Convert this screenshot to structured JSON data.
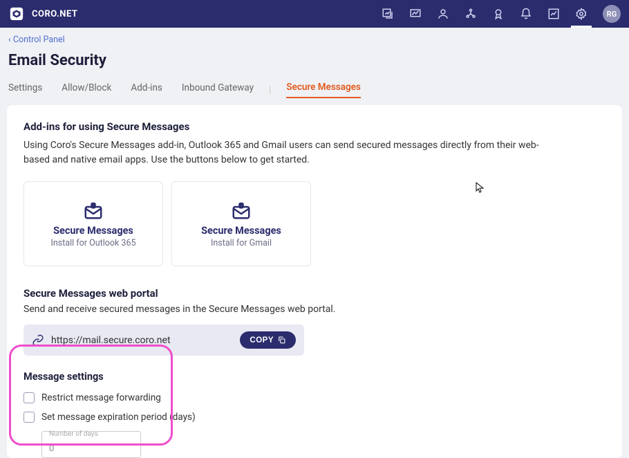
{
  "brand": "CORO.NET",
  "avatar": "RG",
  "breadcrumb": "‹ Control Panel",
  "page_title": "Email Security",
  "tabs": {
    "settings": "Settings",
    "allow_block": "Allow/Block",
    "addins": "Add-ins",
    "inbound_gateway": "Inbound Gateway",
    "secure_messages": "Secure Messages"
  },
  "addins_section": {
    "title": "Add-ins for using Secure Messages",
    "desc": "Using Coro's Secure Messages add-in, Outlook 365 and Gmail users can send secured messages directly from their web-based and native email apps. Use the buttons below to get started.",
    "cards": [
      {
        "title": "Secure Messages",
        "sub": "Install for Outlook 365"
      },
      {
        "title": "Secure Messages",
        "sub": "Install for Gmail"
      }
    ]
  },
  "portal": {
    "title": "Secure Messages web portal",
    "desc": "Send and receive secured messages in the Secure Messages web portal.",
    "url": "https://mail.secure.coro.net",
    "copy_label": "COPY"
  },
  "msg_settings": {
    "title": "Message settings",
    "restrict": "Restrict message forwarding",
    "expiration": "Set message expiration period (days)",
    "days_label": "Number of days",
    "days_value": "0"
  }
}
